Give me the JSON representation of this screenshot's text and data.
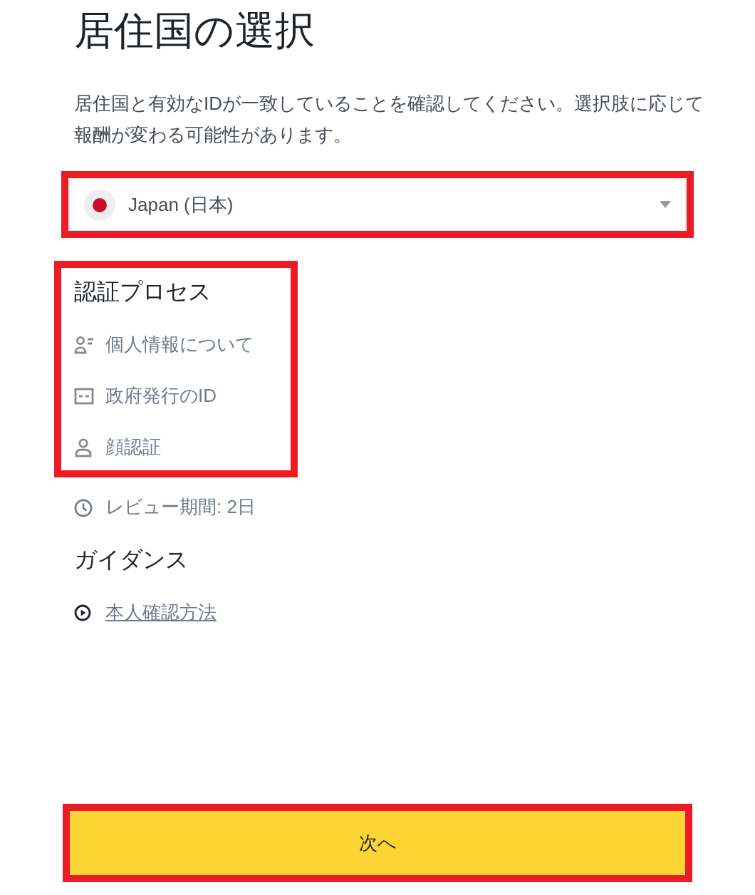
{
  "title": "居住国の選択",
  "description": "居住国と有効なIDが一致していることを確認してください。選択肢に応じて報酬が変わる可能性があります。",
  "country_select": {
    "value": "Japan (日本)",
    "highlighted": true
  },
  "process": {
    "heading": "認証プロセス",
    "highlighted": true,
    "steps": [
      {
        "kind": "personal",
        "label": "個人情報について"
      },
      {
        "kind": "id-card",
        "label": "政府発行のID"
      },
      {
        "kind": "face",
        "label": "顔認証"
      }
    ]
  },
  "review": {
    "label": "レビュー期間: 2日"
  },
  "guidance": {
    "heading": "ガイダンス",
    "link": "本人確認方法"
  },
  "next_button": {
    "label": "次へ",
    "highlighted": true
  }
}
